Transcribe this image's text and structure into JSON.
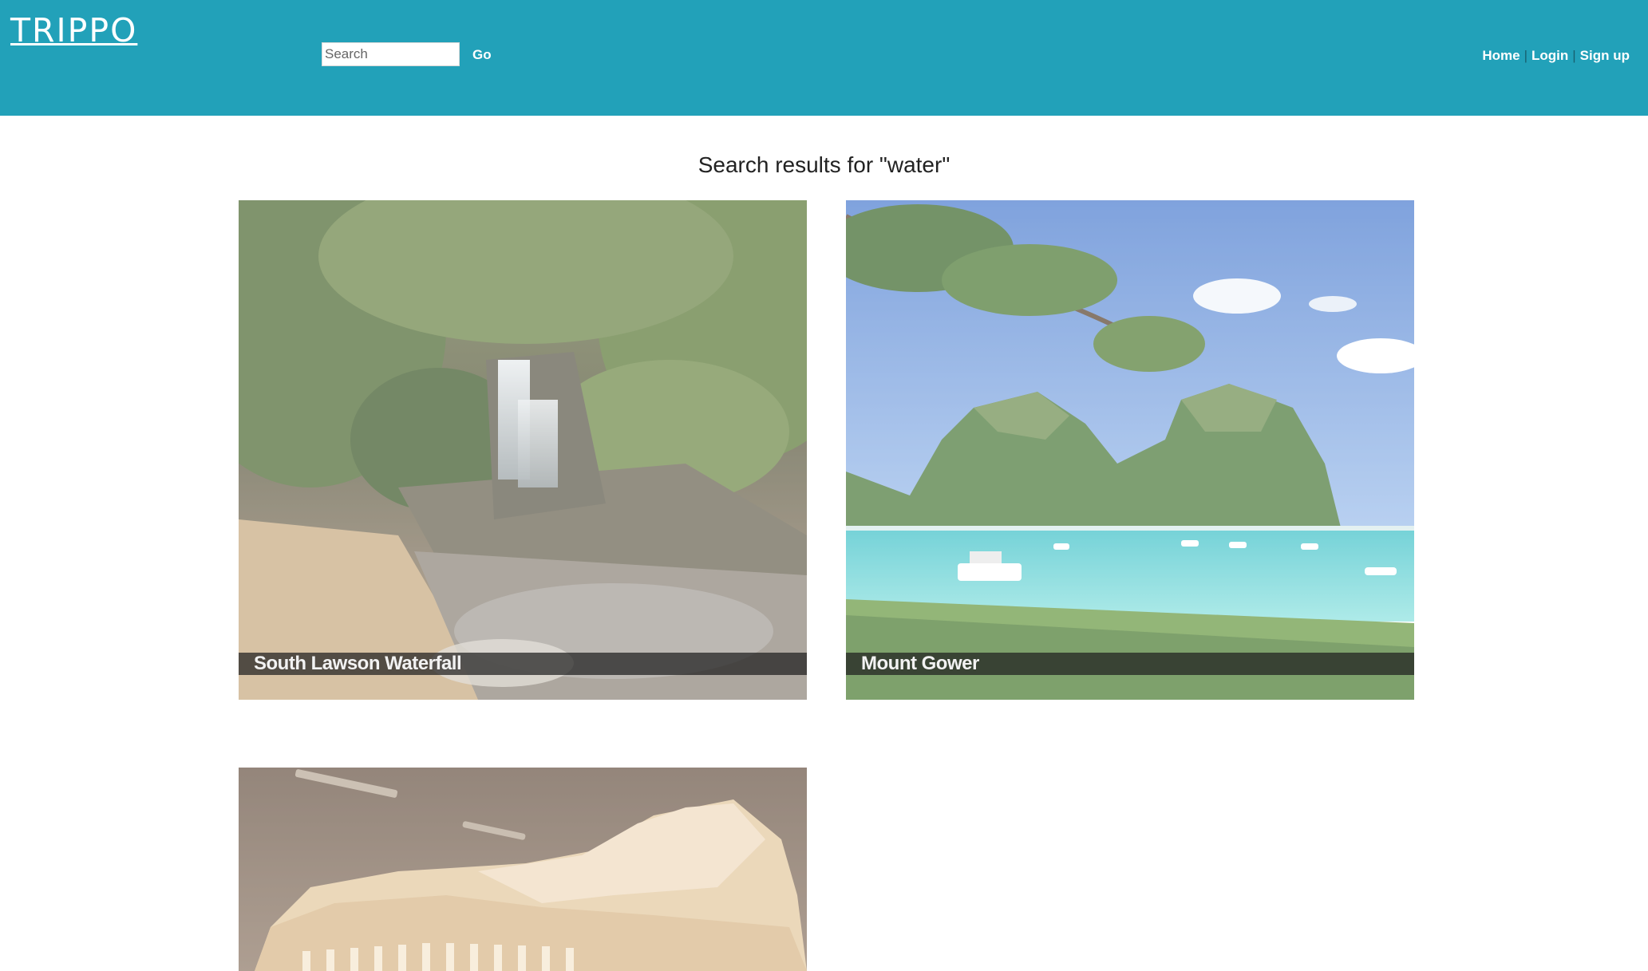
{
  "header": {
    "logo": "TRIPPO",
    "search_placeholder": "Search",
    "go_label": "Go",
    "nav": {
      "home": "Home",
      "login": "Login",
      "signup": "Sign up",
      "separator": "|"
    }
  },
  "main": {
    "title": "Search results for \"water\"",
    "results": [
      {
        "name": "South Lawson Waterfall"
      },
      {
        "name": "Mount Gower"
      },
      {
        "name": ""
      }
    ]
  },
  "colors": {
    "header_bg": "#22a1b9",
    "caption_bg": "#1e1e1e"
  }
}
